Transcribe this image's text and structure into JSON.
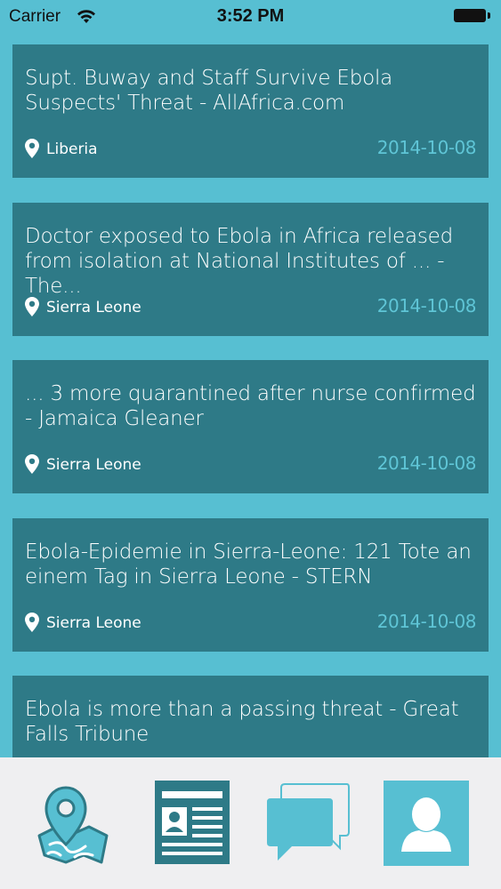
{
  "status_bar": {
    "carrier": "Carrier",
    "time": "3:52 PM"
  },
  "feed": {
    "items": [
      {
        "title": "Supt. Buway and Staff Survive Ebola Suspects' Threat - AllAfrica.com",
        "location": "Liberia",
        "date": "2014-10-08"
      },
      {
        "title": "Doctor exposed to Ebola in Africa released from isolation at National Institutes of ... - The...",
        "location": "Sierra Leone",
        "date": "2014-10-08"
      },
      {
        "title": "... 3 more quarantined after nurse confirmed - Jamaica Gleaner",
        "location": "Sierra Leone",
        "date": "2014-10-08"
      },
      {
        "title": "Ebola-Epidemie in Sierra-Leone: 121 Tote an einem Tag in Sierra Leone - STERN",
        "location": "Sierra Leone",
        "date": "2014-10-08"
      },
      {
        "title": "Ebola is more than a passing threat - Great Falls Tribune",
        "location": "",
        "date": ""
      }
    ]
  },
  "tab_bar": {
    "tabs": [
      {
        "icon": "map-pin-icon"
      },
      {
        "icon": "news-icon"
      },
      {
        "icon": "chat-icon"
      },
      {
        "icon": "profile-icon"
      }
    ]
  },
  "colors": {
    "background": "#57bfd2",
    "card": "#2e7a87",
    "date_text": "#5fc5d6",
    "tab_bar": "#efeff1",
    "icon_dark": "#2e7a87",
    "icon_light": "#57bfd2"
  }
}
